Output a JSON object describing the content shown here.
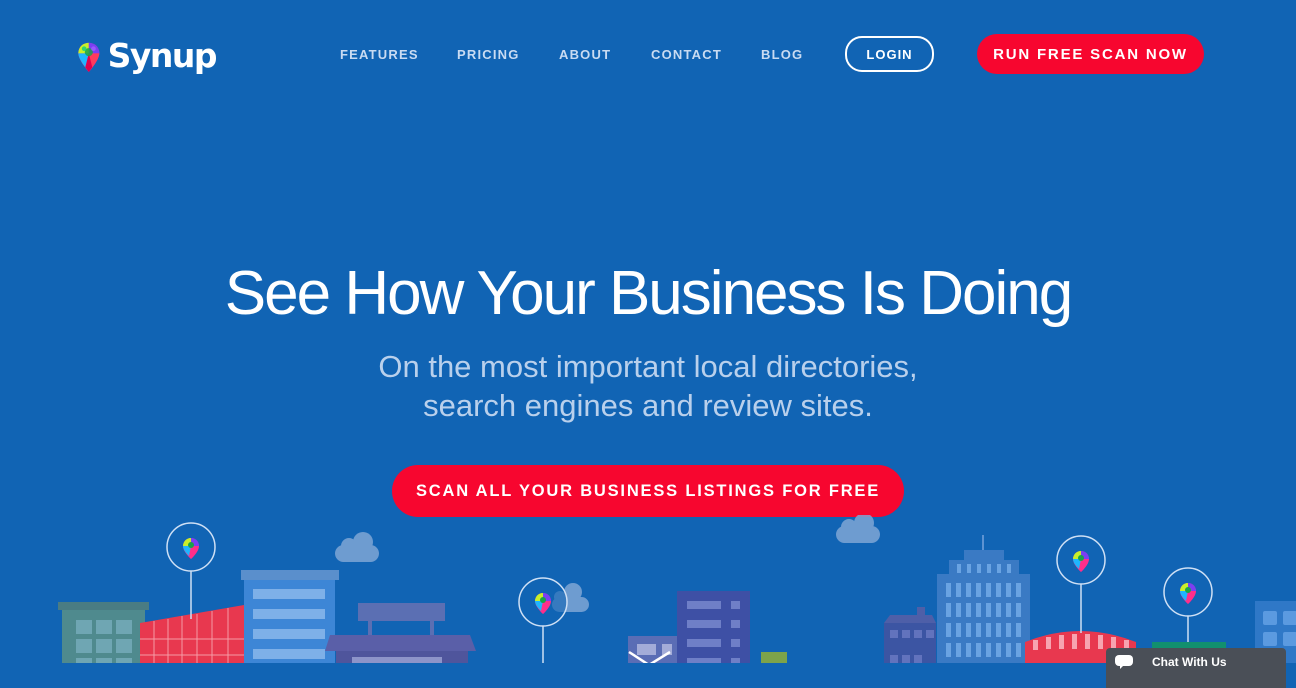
{
  "brand": {
    "name": "Synup",
    "logo_icon": "map-pin-logo-icon"
  },
  "nav": {
    "items": [
      {
        "label": "FEATURES"
      },
      {
        "label": "PRICING"
      },
      {
        "label": "ABOUT"
      },
      {
        "label": "CONTACT"
      },
      {
        "label": "BLOG"
      }
    ],
    "login_label": "LOGIN",
    "scan_now_label": "RUN FREE SCAN NOW"
  },
  "hero": {
    "title": "See How Your Business Is Doing",
    "subtitle_line1": "On the most important local directories,",
    "subtitle_line2": "search engines and review sites.",
    "cta_label": "SCAN ALL YOUR BUSINESS LISTINGS FOR FREE"
  },
  "chat": {
    "label": "Chat With Us",
    "icon": "chat-bubble-icon"
  },
  "colors": {
    "background": "#1164b4",
    "accent": "#f7062f",
    "nav_text": "#c9dbf2",
    "subtitle_text": "#b9d0ec"
  }
}
